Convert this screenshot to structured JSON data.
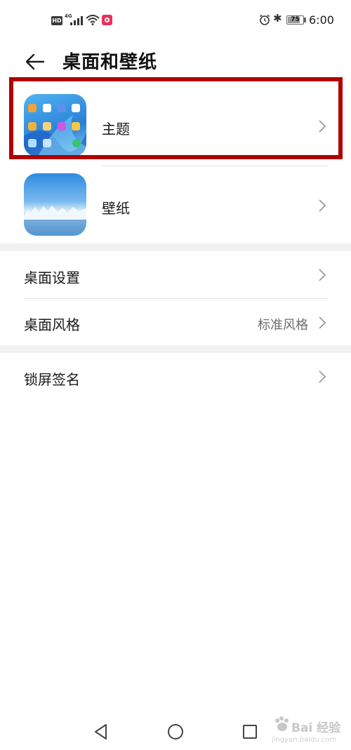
{
  "status_bar": {
    "hd": "HD",
    "network": "4G",
    "battery": "75",
    "time": "6:00"
  },
  "header": {
    "title": "桌面和壁纸"
  },
  "items": [
    {
      "label": "主题"
    },
    {
      "label": "壁纸"
    },
    {
      "label": "桌面设置"
    },
    {
      "label": "桌面风格",
      "value": "标准风格"
    },
    {
      "label": "锁屏签名"
    }
  ],
  "watermark": {
    "brand": "Bai 经验",
    "url": "jingyan.baidu.com"
  },
  "colors": {
    "highlight": "#b00000",
    "separator": "#f1f1f1",
    "secondary_text": "#6e6e6e"
  }
}
